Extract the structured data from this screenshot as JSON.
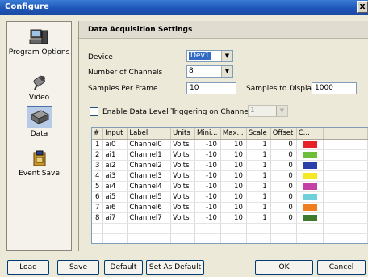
{
  "window": {
    "title": "Configure",
    "close_label": "x"
  },
  "sidebar": {
    "items": [
      {
        "label": "Program Options",
        "icon": "computer-icon",
        "selected": false
      },
      {
        "label": "Video",
        "icon": "camera-icon",
        "selected": false
      },
      {
        "label": "Data",
        "icon": "daq-device-icon",
        "selected": true
      },
      {
        "label": "Event Save",
        "icon": "save-box-icon",
        "selected": false
      }
    ]
  },
  "panel": {
    "title": "Data Acquisition Settings",
    "device": {
      "label": "Device",
      "value": "Dev1"
    },
    "channels": {
      "label": "Number of Channels",
      "value": "8"
    },
    "samples_per_frame": {
      "label": "Samples Per Frame",
      "value": "10"
    },
    "samples_to_display": {
      "label": "Samples to Display",
      "value": "1000"
    },
    "trigger": {
      "label": "Enable Data Level Triggering on Channel #",
      "checked": false,
      "value": "1"
    }
  },
  "table": {
    "columns": [
      "#",
      "Input",
      "Label",
      "Units",
      "Mini...",
      "Max...",
      "Scale",
      "Offset",
      "C..."
    ],
    "rows": [
      {
        "n": "1",
        "input": "ai0",
        "label": "Channel0",
        "units": "Volts",
        "min": "-10",
        "max": "10",
        "scale": "1",
        "offset": "0",
        "color": "#e8202a"
      },
      {
        "n": "2",
        "input": "ai1",
        "label": "Channel1",
        "units": "Volts",
        "min": "-10",
        "max": "10",
        "scale": "1",
        "offset": "0",
        "color": "#6dbf3a"
      },
      {
        "n": "3",
        "input": "ai2",
        "label": "Channel2",
        "units": "Volts",
        "min": "-10",
        "max": "10",
        "scale": "1",
        "offset": "0",
        "color": "#2b3fa8"
      },
      {
        "n": "4",
        "input": "ai3",
        "label": "Channel3",
        "units": "Volts",
        "min": "-10",
        "max": "10",
        "scale": "1",
        "offset": "0",
        "color": "#f4e923"
      },
      {
        "n": "5",
        "input": "ai4",
        "label": "Channel4",
        "units": "Volts",
        "min": "-10",
        "max": "10",
        "scale": "1",
        "offset": "0",
        "color": "#c43fa6"
      },
      {
        "n": "6",
        "input": "ai5",
        "label": "Channel5",
        "units": "Volts",
        "min": "-10",
        "max": "10",
        "scale": "1",
        "offset": "0",
        "color": "#6fd0dc"
      },
      {
        "n": "7",
        "input": "ai6",
        "label": "Channel6",
        "units": "Volts",
        "min": "-10",
        "max": "10",
        "scale": "1",
        "offset": "0",
        "color": "#f07d1e"
      },
      {
        "n": "8",
        "input": "ai7",
        "label": "Channel7",
        "units": "Volts",
        "min": "-10",
        "max": "10",
        "scale": "1",
        "offset": "0",
        "color": "#3d7a2c"
      }
    ]
  },
  "buttons": {
    "load": "Load",
    "save": "Save",
    "default": "Default",
    "set_as_default": "Set As Default",
    "ok": "OK",
    "cancel": "Cancel"
  }
}
